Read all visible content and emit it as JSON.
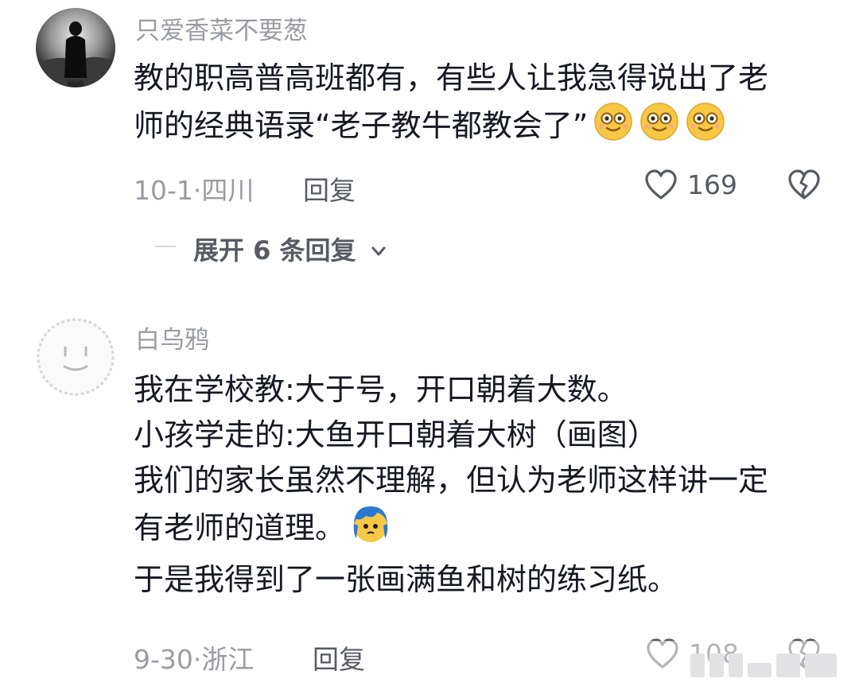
{
  "comments": [
    {
      "username": "只爱香菜不要葱",
      "lines": [
        "教的职高普高班都有，有些人让我急得说出了老",
        "师的经典语录“老子教牛都教会了”"
      ],
      "emoji_count": 3,
      "date": "10-1",
      "location": "四川",
      "meta_separator": "·",
      "reply_label": "回复",
      "likes": "169",
      "expand_label": "展开 6 条回复"
    },
    {
      "username": "白乌鸦",
      "lines": [
        "我在学校教:大于号，开口朝着大数。",
        "小孩学走的:大鱼开口朝着大树（画图）",
        "我们的家长虽然不理解，但认为老师这样讲一定",
        "有老师的道理。",
        "于是我得到了一张画满鱼和树的练习纸。"
      ],
      "date": "9-30",
      "location": "浙江",
      "meta_separator": "·",
      "reply_label": "回复",
      "likes": "108"
    }
  ],
  "icons": {
    "like": "heart-outline-icon",
    "dislike": "broken-heart-icon",
    "expand": "chevron-down-icon",
    "smile_emoji": "smiling-face-emoji",
    "blue_hair_emoji": "blue-hair-face-emoji"
  },
  "colors": {
    "text": "#161823",
    "secondary": "#9a9ca3",
    "action": "#585b63",
    "divider": "#d6d7da"
  }
}
